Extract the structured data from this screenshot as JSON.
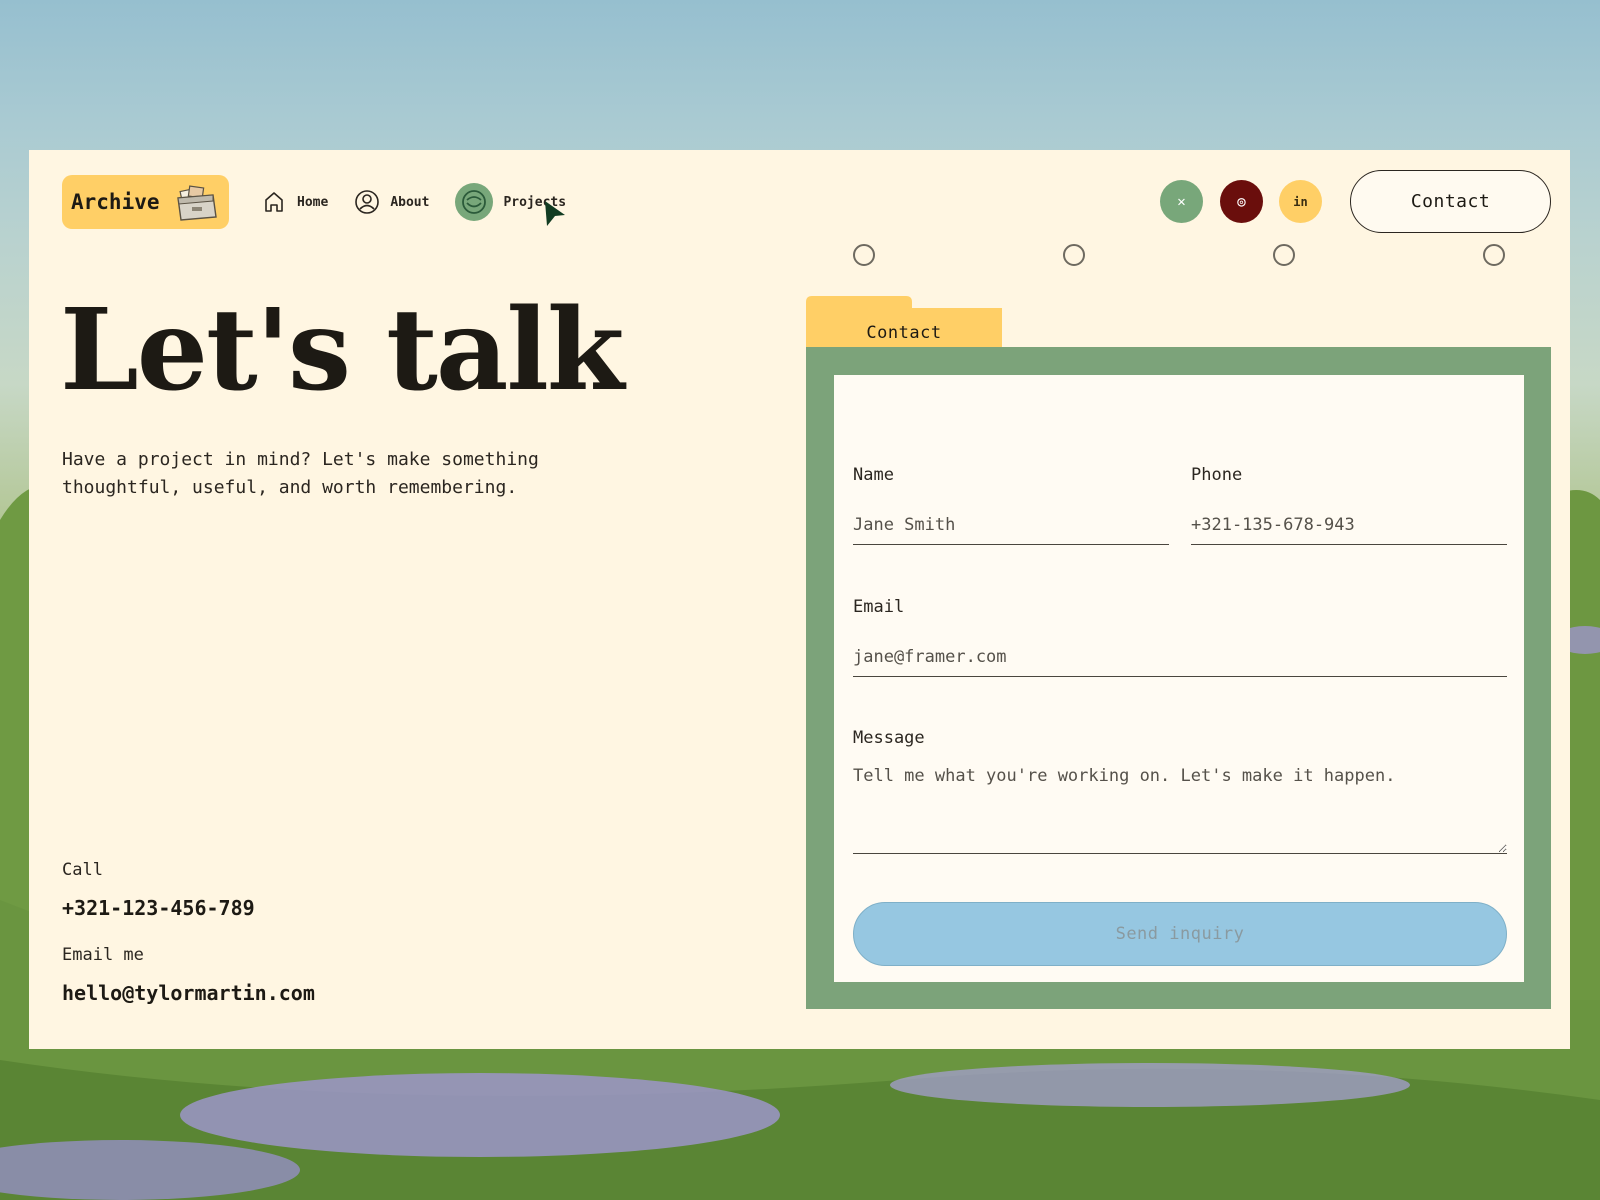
{
  "nav": {
    "logo_text": "Archive",
    "items": [
      {
        "label": "Home",
        "icon": "home-icon"
      },
      {
        "label": "About",
        "icon": "user-icon"
      },
      {
        "label": "Projects",
        "icon": "projects-icon"
      }
    ],
    "social": [
      {
        "icon": "x-icon",
        "glyph": "✕",
        "color": "#78a77a"
      },
      {
        "icon": "instagram-icon",
        "glyph": "◎",
        "color": "#6a0e0c"
      },
      {
        "icon": "linkedin-icon",
        "glyph": "in",
        "color": "#ffcf66"
      }
    ],
    "contact_label": "Contact"
  },
  "hero": {
    "title": "Let's talk",
    "subtitle": "Have a project in mind? Let's make something thoughtful, useful, and worth remembering."
  },
  "info": {
    "call_label": "Call",
    "call_value": "+321-123-456-789",
    "email_label": "Email me",
    "email_value": "hello@tylormartin.com"
  },
  "form": {
    "tab_label": "Contact",
    "name_label": "Name",
    "name_placeholder": "Jane Smith",
    "phone_label": "Phone",
    "phone_placeholder": "+321-135-678-943",
    "email_label": "Email",
    "email_placeholder": "jane@framer.com",
    "message_label": "Message",
    "message_placeholder": "Tell me what you're working on. Let's make it happen.",
    "submit_label": "Send inquiry"
  },
  "colors": {
    "accent_yellow": "#ffcf66",
    "accent_green": "#7ca37a",
    "panel": "#fff6e2",
    "button_blue": "#96c7e1"
  }
}
